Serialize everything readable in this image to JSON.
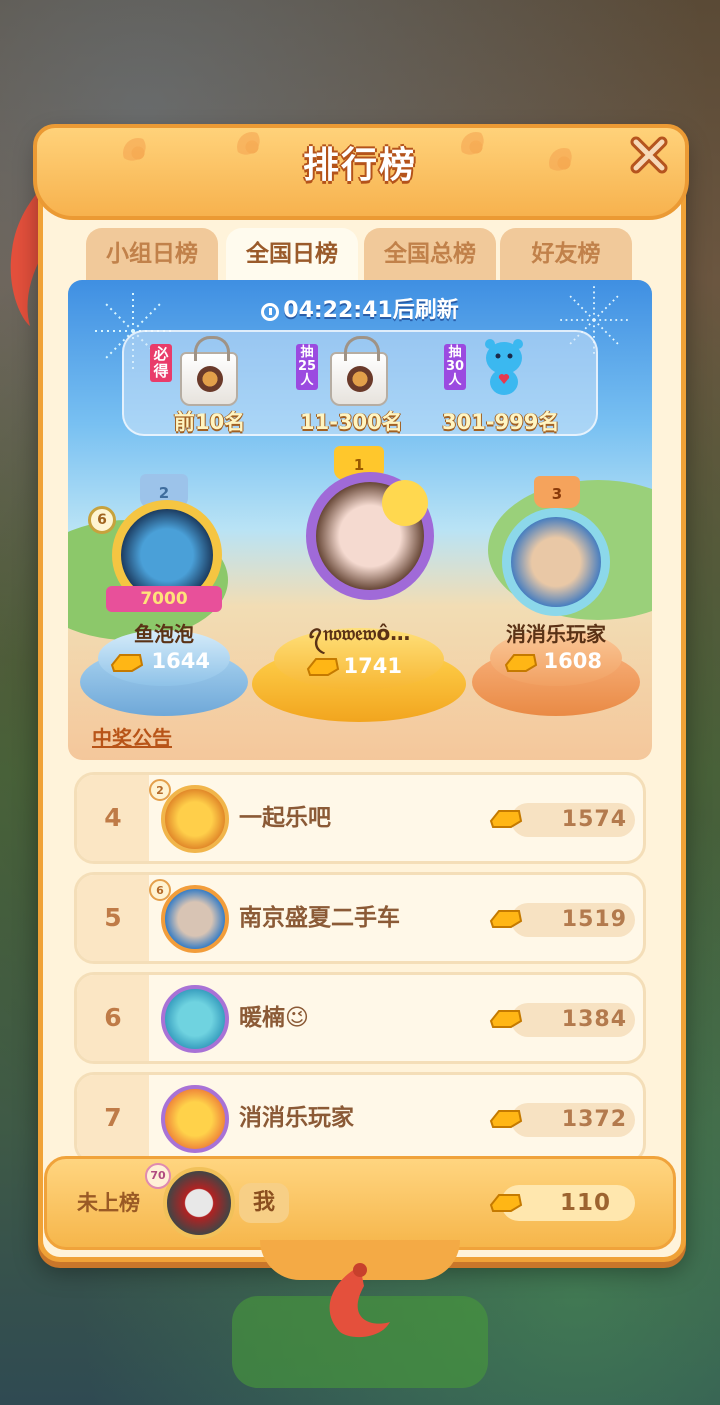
{
  "background": {
    "blurred_title": ""
  },
  "panel": {
    "title": "排行榜",
    "tabs": [
      "小组日榜",
      "全国日榜",
      "全国总榜",
      "好友榜"
    ],
    "active_tab": 1
  },
  "refresh": {
    "countdown": "04:22:41",
    "suffix": "后刷新"
  },
  "rewards": [
    {
      "tag": "必\n得",
      "label": "前10名",
      "item": "bag"
    },
    {
      "tag": "抽\n25\n人",
      "label": "11-300名",
      "item": "bag"
    },
    {
      "tag": "抽\n30\n人",
      "label": "301-999名",
      "item": "toy"
    }
  ],
  "podium": [
    {
      "place": "2",
      "name": "鱼泡泡",
      "score": "1644",
      "level": "6",
      "frame_text": "7000"
    },
    {
      "place": "1",
      "name": "ꪖ𝔫𝔬𝔴𝔢𝔴ô…",
      "score": "1741"
    },
    {
      "place": "3",
      "name": "消消乐玩家",
      "score": "1608"
    }
  ],
  "notice_link": "中奖公告",
  "list": [
    {
      "rank": "4",
      "name": "一起乐吧",
      "score": "1574",
      "level": "2"
    },
    {
      "rank": "5",
      "name": "南京盛夏二手车",
      "score": "1519",
      "level": "6"
    },
    {
      "rank": "6",
      "name": "暖楠😉",
      "score": "1384",
      "level": ""
    },
    {
      "rank": "7",
      "name": "消消乐玩家",
      "score": "1372",
      "level": ""
    }
  ],
  "me": {
    "status": "未上榜",
    "name": "我",
    "score": "110",
    "level": "70"
  },
  "colors": {
    "panel": "#fff3da",
    "border": "#f0a237",
    "accent": "#b85418",
    "gold": "#f6b64b"
  }
}
